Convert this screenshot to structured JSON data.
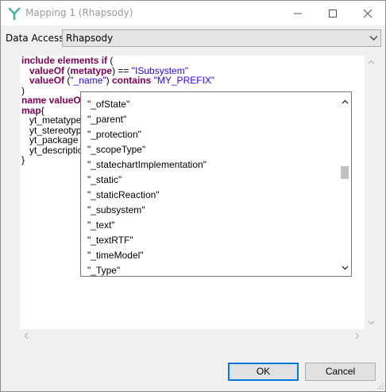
{
  "window": {
    "title": "Mapping 1 (Rhapsody)"
  },
  "data_access": {
    "label": "Data Access:",
    "value": "Rhapsody"
  },
  "editor": {
    "lines": [
      [
        {
          "t": "include elements if",
          "c": "kw"
        },
        {
          "t": " (",
          "c": ""
        }
      ],
      [
        {
          "t": "   ",
          "c": ""
        },
        {
          "t": "valueOf",
          "c": "kw"
        },
        {
          "t": " (",
          "c": ""
        },
        {
          "t": "metatype",
          "c": "kw"
        },
        {
          "t": ") == ",
          "c": ""
        },
        {
          "t": "\"ISubsystem\"",
          "c": "str"
        }
      ],
      [
        {
          "t": "   ",
          "c": ""
        },
        {
          "t": "valueOf",
          "c": "kw"
        },
        {
          "t": " (",
          "c": ""
        },
        {
          "t": "\"_name\"",
          "c": "str"
        },
        {
          "t": ") ",
          "c": ""
        },
        {
          "t": "contains",
          "c": "kw"
        },
        {
          "t": " ",
          "c": ""
        },
        {
          "t": "\"MY_PREFIX\"",
          "c": "str"
        }
      ],
      [
        {
          "t": ")",
          "c": ""
        }
      ],
      [
        {
          "t": "name valueOf",
          "c": "kw"
        }
      ],
      [
        {
          "t": "map",
          "c": "kw"
        },
        {
          "t": "{",
          "c": ""
        }
      ],
      [
        {
          "t": "   yt_metatype",
          "c": ""
        }
      ],
      [
        {
          "t": "   yt_stereotyp",
          "c": ""
        }
      ],
      [
        {
          "t": "   yt_package",
          "c": ""
        }
      ],
      [
        {
          "t": "   yt_descriptio",
          "c": ""
        }
      ],
      [
        {
          "t": "}",
          "c": ""
        }
      ]
    ]
  },
  "autocomplete": {
    "items": [
      "\"_ofState\"",
      "\"_parent\"",
      "\"_protection\"",
      "\"_scopeType\"",
      "\"_statechartImplementation\"",
      "\"_static\"",
      "\"_staticReaction\"",
      "\"_subsystem\"",
      "\"_text\"",
      "\"_textRTF\"",
      "\"_timeModel\"",
      "\"_Type\""
    ]
  },
  "buttons": {
    "ok": "OK",
    "cancel": "Cancel"
  },
  "colors": {
    "keyword": "#7f0055",
    "string": "#2a00ff",
    "accent": "#0078d7",
    "app_icon": "#3cb4a0"
  },
  "icons": {
    "app": "tree-icon",
    "minimize": "minimize-icon",
    "maximize": "maximize-icon",
    "close": "close-icon"
  }
}
